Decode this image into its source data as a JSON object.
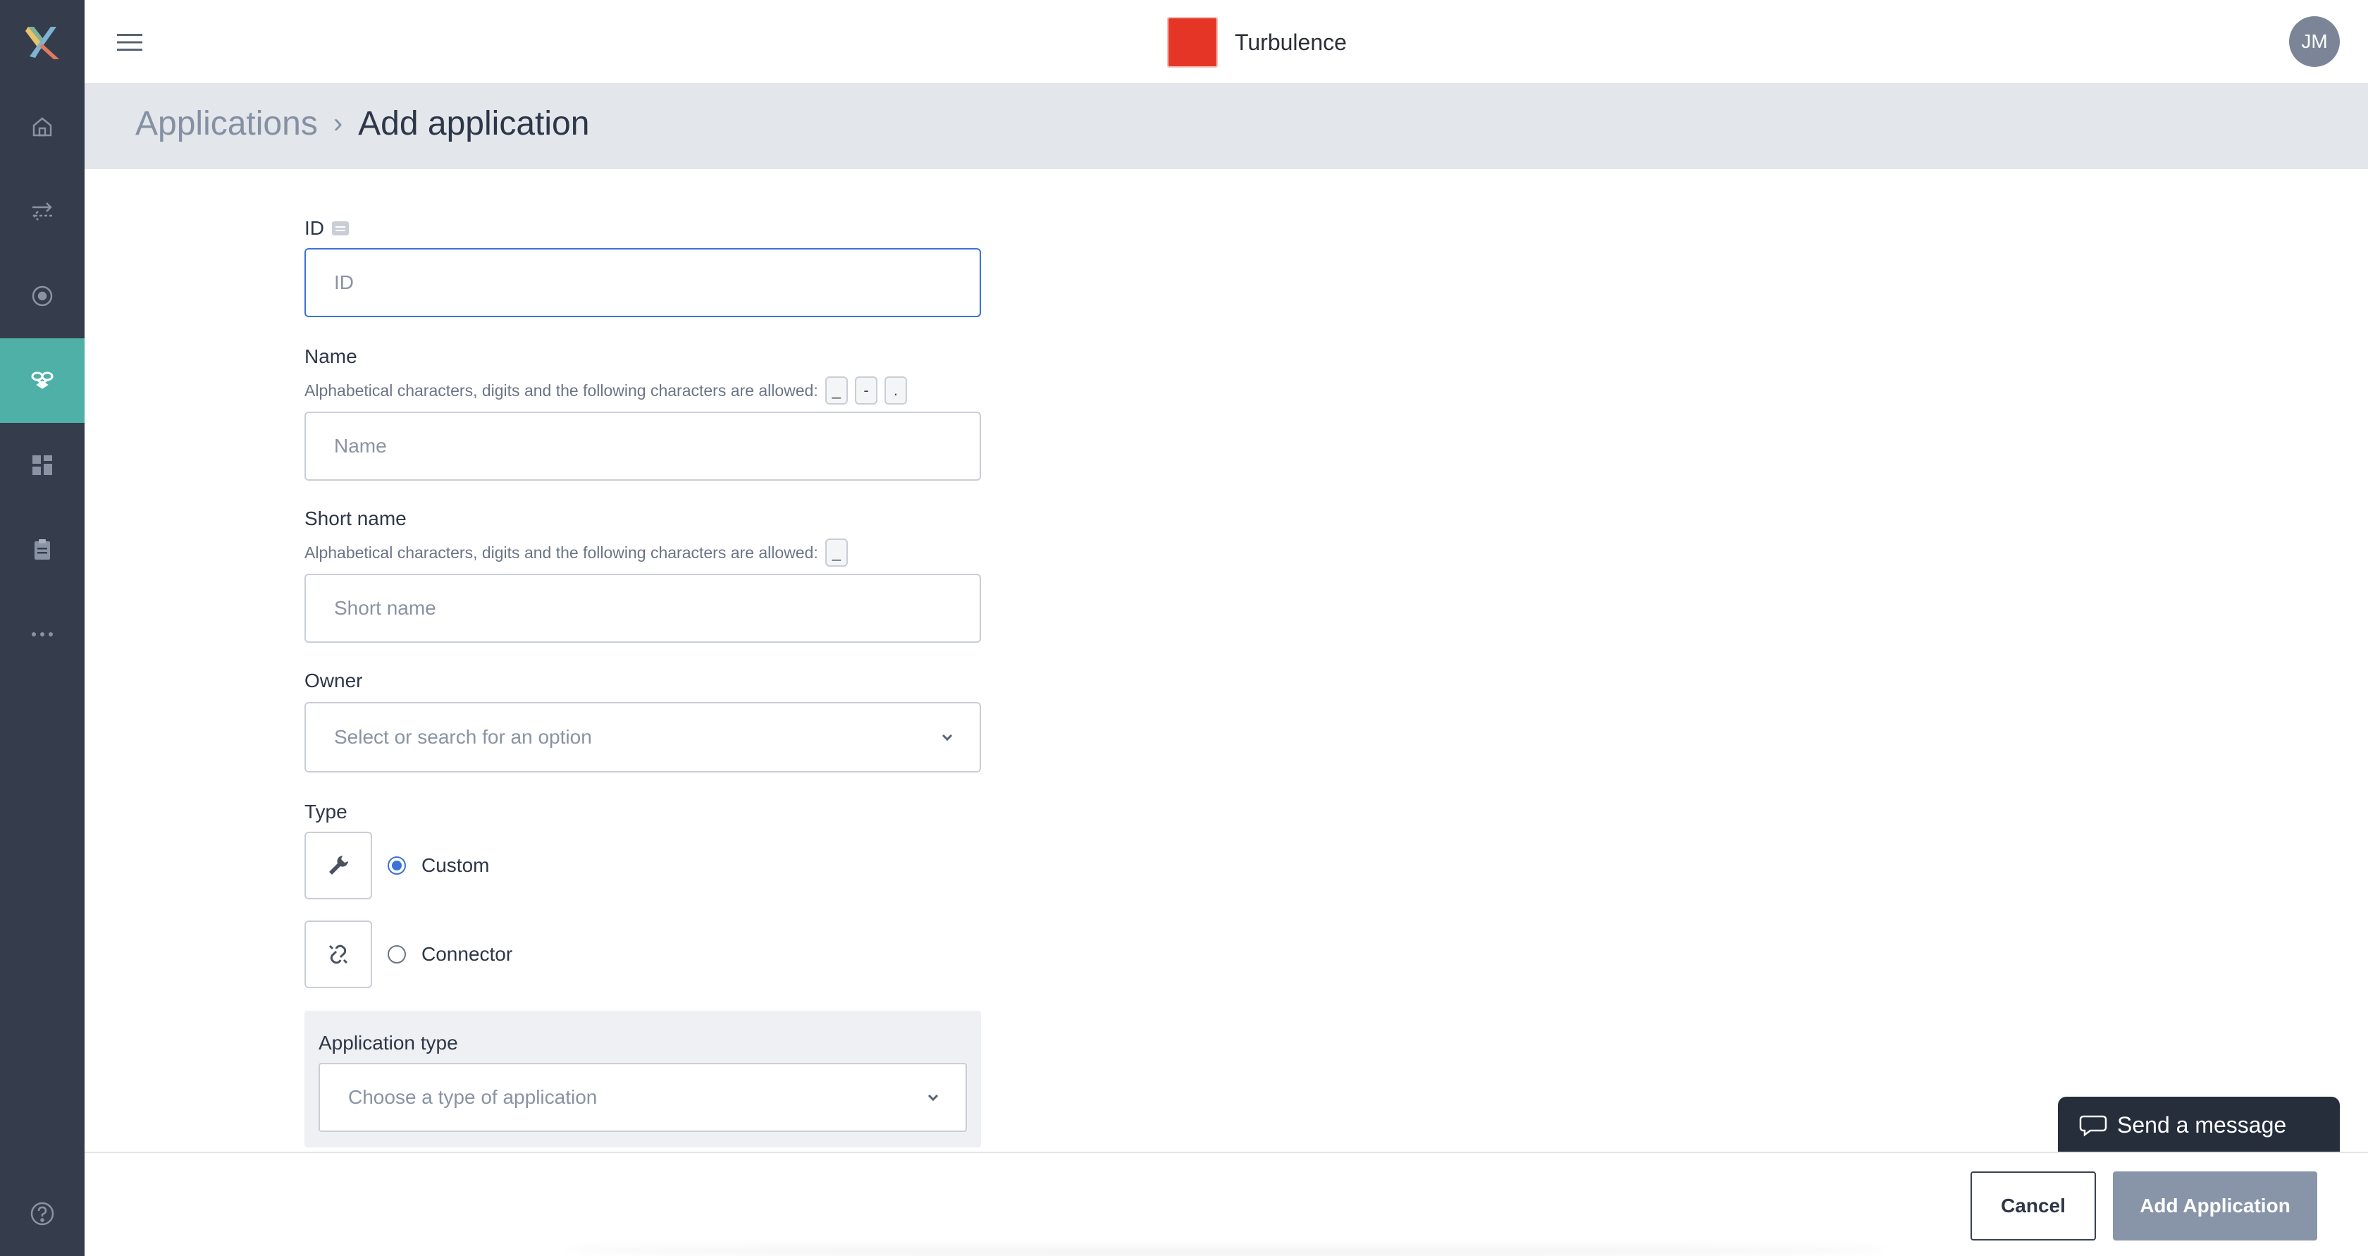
{
  "header": {
    "brand_name": "Turbulence",
    "avatar_initials": "JM"
  },
  "breadcrumb": {
    "parent": "Applications",
    "separator": "›",
    "current": "Add application"
  },
  "form": {
    "id": {
      "label": "ID",
      "placeholder": "ID",
      "value": ""
    },
    "name": {
      "label": "Name",
      "hint": "Alphabetical characters, digits and the following characters are allowed:",
      "allowed_chars": [
        "_",
        "-",
        "."
      ],
      "placeholder": "Name",
      "value": ""
    },
    "short_name": {
      "label": "Short name",
      "hint": "Alphabetical characters, digits and the following characters are allowed:",
      "allowed_chars": [
        "_"
      ],
      "placeholder": "Short name",
      "value": ""
    },
    "owner": {
      "label": "Owner",
      "placeholder": "Select or search for an option"
    },
    "type": {
      "label": "Type",
      "options": [
        {
          "label": "Custom",
          "icon": "wrench-icon",
          "selected": true
        },
        {
          "label": "Connector",
          "icon": "link-icon",
          "selected": false
        }
      ]
    },
    "application_type": {
      "label": "Application type",
      "placeholder": "Choose a type of application"
    }
  },
  "actions": {
    "cancel_label": "Cancel",
    "add_label": "Add Application"
  },
  "chat": {
    "label": "Send a message"
  },
  "colors": {
    "sidebar_bg": "#353d4c",
    "sidebar_active": "#4fb0a8",
    "focus_blue": "#3b72d9",
    "brand_red": "#e53527",
    "primary_button_disabled": "#8894a8"
  }
}
